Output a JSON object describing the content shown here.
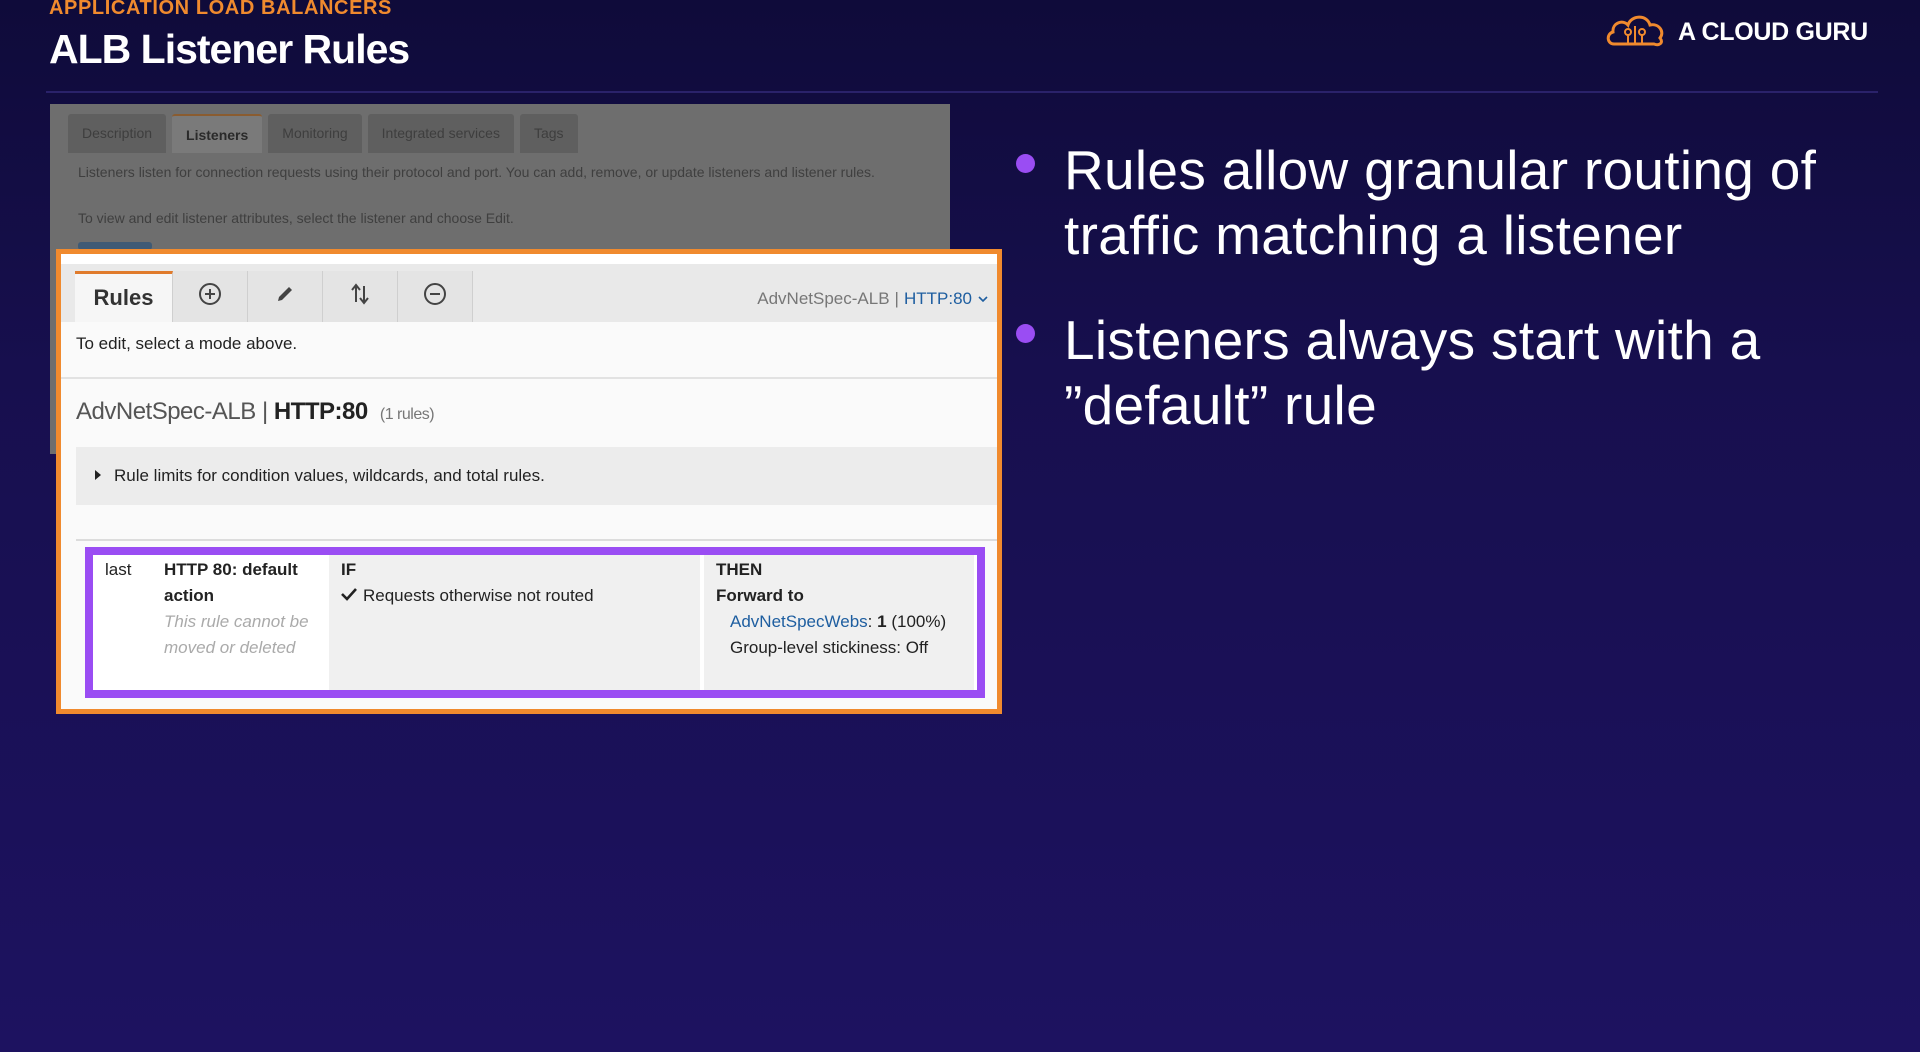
{
  "header": {
    "eyebrow": "APPLICATION LOAD BALANCERS",
    "title": "ALB Listener Rules",
    "brand": "A CLOUD GURU",
    "brand_color": "#f08a2e"
  },
  "console_background": {
    "tabs": [
      "Description",
      "Listeners",
      "Monitoring",
      "Integrated services",
      "Tags"
    ],
    "active_tab": "Listeners",
    "line1": "Listeners listen for connection requests using their protocol and port. You can add, remove, or update listeners and listener rules.",
    "line2": "To view and edit listener attributes, select the listener and choose Edit."
  },
  "rules_editor": {
    "rules_tab": "Rules",
    "tool_icons": [
      "plus-circle-icon",
      "pencil-icon",
      "reorder-arrows-icon",
      "minus-circle-icon"
    ],
    "listener_selector": {
      "lb_name": "AdvNetSpec-ALB",
      "separator": "|",
      "listener": "HTTP:80"
    },
    "edit_hint": "To edit, select a mode above.",
    "heading": {
      "lb_name": "AdvNetSpec-ALB",
      "separator": "|",
      "listener": "HTTP:80",
      "count": "(1 rules)"
    },
    "limits_text": "Rule limits for condition values, wildcards, and total rules.",
    "rule": {
      "priority": "last",
      "name": "HTTP 80: default action",
      "note": "This rule cannot be moved or deleted",
      "if_label": "IF",
      "condition": "Requests otherwise not routed",
      "then_label": "THEN",
      "action_label": "Forward to",
      "target_group": "AdvNetSpecWebs",
      "target_sep": ":",
      "weight": "1",
      "weight_pct": "(100%)",
      "stickiness": "Group-level stickiness: Off"
    },
    "highlight_colors": {
      "outer": "#f08a2e",
      "rule": "#9a4df3",
      "link": "#1e5ea0"
    }
  },
  "bullets": [
    {
      "text": "Rules allow granular routing of traffic matching a listener"
    },
    {
      "text": "Listeners always start with a ”default” rule"
    }
  ]
}
